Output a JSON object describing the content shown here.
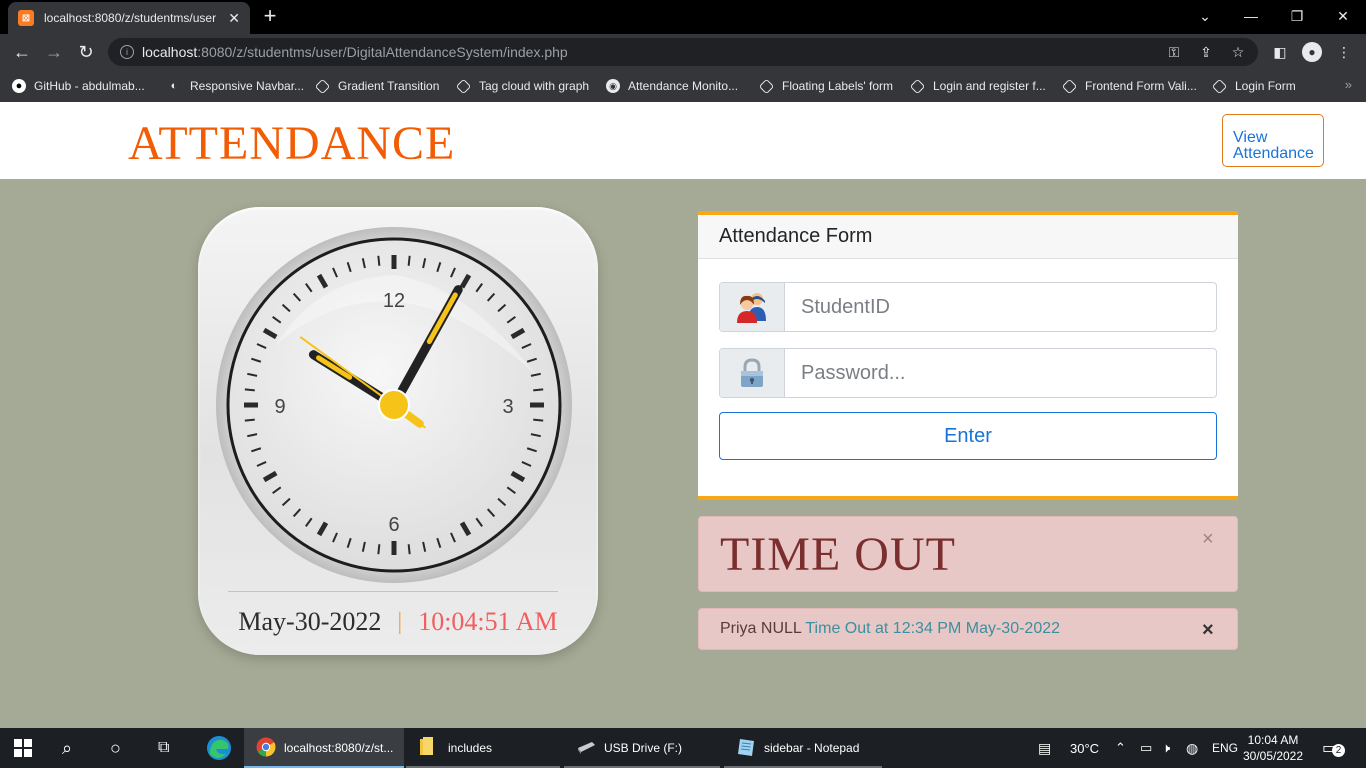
{
  "browser": {
    "tab_title": "localhost:8080/z/studentms/user/",
    "tab_close": "✕",
    "new_tab": "+",
    "url_host": "localhost",
    "url_path": ":8080/z/studentms/user/DigitalAttendanceSystem/index.php",
    "bookmarks": [
      {
        "label": "GitHub - abdulmab...",
        "icon": "github-icon"
      },
      {
        "label": "Responsive Navbar...",
        "icon": "site-icon"
      },
      {
        "label": "Gradient Transition",
        "icon": "codepen-icon"
      },
      {
        "label": "Tag cloud with graph",
        "icon": "codepen-icon"
      },
      {
        "label": "Attendance Monito...",
        "icon": "globe-icon"
      },
      {
        "label": "Floating Labels' form",
        "icon": "codepen-icon"
      },
      {
        "label": "Login and register f...",
        "icon": "codepen-icon"
      },
      {
        "label": "Frontend Form Vali...",
        "icon": "codepen-icon"
      },
      {
        "label": "Login Form",
        "icon": "codepen-icon"
      }
    ]
  },
  "header": {
    "brand": "ATTENDANCE",
    "view_button": "View Attendance"
  },
  "clock": {
    "numerals": {
      "twelve": "12",
      "three": "3",
      "six": "6",
      "nine": "9"
    },
    "date": "May-30-2022",
    "separator": "|",
    "time": "10:04:51 AM",
    "hands": {
      "hour": 10,
      "minute": 4,
      "second": 51
    }
  },
  "form": {
    "title": "Attendance Form",
    "student_placeholder": "StudentID",
    "password_placeholder": "Password...",
    "submit_label": "Enter"
  },
  "alerts": {
    "status_text": "TIME OUT",
    "close_glyph": "×",
    "name": "Priya NULL",
    "message": "Time Out at 12:34 PM May-30-2022"
  },
  "taskbar": {
    "apps": [
      {
        "label": "localhost:8080/z/st...",
        "icon": "chrome-icon"
      },
      {
        "label": "includes",
        "icon": "folder-icon"
      },
      {
        "label": "USB Drive (F:)",
        "icon": "usb-drive-icon"
      },
      {
        "label": "sidebar - Notepad",
        "icon": "notepad-icon"
      }
    ],
    "temperature": "30°C",
    "language": "ENG",
    "clock_time": "10:04 AM",
    "clock_date": "30/05/2022",
    "notification_count": "2"
  },
  "colors": {
    "brand": "#f25c05",
    "card_accent": "#f7a616",
    "page_background": "#a4aa95",
    "link_blue": "#1a73d8",
    "alert_background": "#e8c8c6"
  }
}
